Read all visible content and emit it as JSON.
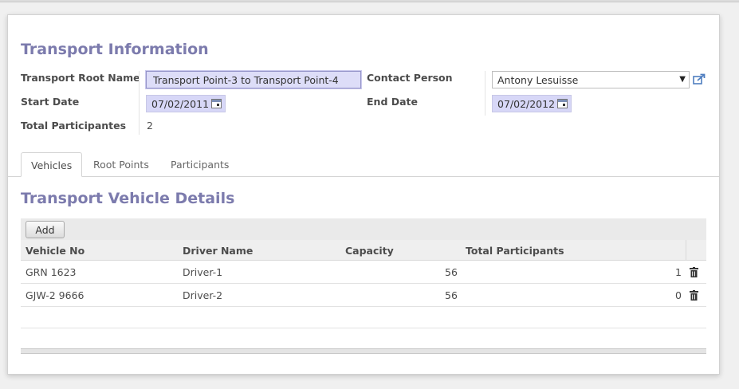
{
  "form": {
    "title": "Transport Information",
    "fields": {
      "root_name_label": "Transport Root Name",
      "root_name_value": "Transport Point-3 to Transport Point-4",
      "start_date_label": "Start Date",
      "start_date_value": "07/02/2011",
      "total_participants_label": "Total Participantes",
      "total_participants_value": "2",
      "contact_person_label": "Contact Person",
      "contact_person_value": "Antony Lesuisse",
      "end_date_label": "End Date",
      "end_date_value": "07/02/2012"
    }
  },
  "tabs": [
    {
      "label": "Vehicles",
      "active": true
    },
    {
      "label": "Root Points",
      "active": false
    },
    {
      "label": "Participants",
      "active": false
    }
  ],
  "vehicles": {
    "title": "Transport Vehicle Details",
    "add_label": "Add",
    "columns": [
      "Vehicle No",
      "Driver Name",
      "Capacity",
      "Total Participants"
    ],
    "rows": [
      {
        "vehicle_no": "GRN 1623",
        "driver": "Driver-1",
        "capacity": "56",
        "total": "1"
      },
      {
        "vehicle_no": "GJW-2 9666",
        "driver": "Driver-2",
        "capacity": "56",
        "total": "0"
      }
    ]
  },
  "colors": {
    "title_color": "#7c7bad",
    "input_bg": "#ddddf8",
    "sheet_bg": "#ffffff"
  },
  "icons": {
    "calendar": "calendar-icon",
    "external_link": "external-link-icon",
    "delete": "trash-icon",
    "dropdown": "caret-down-icon"
  }
}
